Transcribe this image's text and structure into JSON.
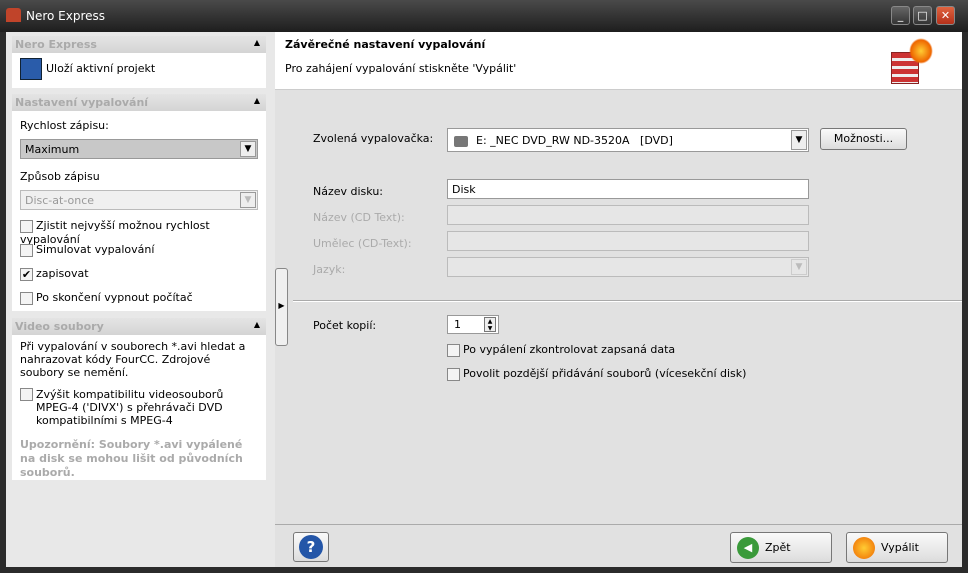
{
  "window": {
    "title": "Nero Express"
  },
  "left": {
    "sec1": {
      "title": "Nero Express",
      "save": "Uloží aktivní projekt"
    },
    "sec2": {
      "title": "Nastavení vypalování",
      "speed_label": "Rychlost zápisu:",
      "speed_value": "Maximum",
      "method_label": "Způsob zápisu",
      "method_value": "Disc-at-once",
      "checks": [
        {
          "label": "Zjistit nejvyšší možnou rychlost vypalování",
          "checked": false
        },
        {
          "label": "Simulovat vypalování",
          "checked": false
        },
        {
          "label": "zapisovat",
          "checked": true
        },
        {
          "label": "Po skončení vypnout počítač",
          "checked": false
        }
      ]
    },
    "sec3": {
      "title": "Video soubory",
      "desc": "Při vypalování v souborech *.avi hledat a nahrazovat kódy FourCC. Zdrojové soubory se nemění.",
      "check": "Zvýšit kompatibilitu videosouborů MPEG-4 ('DIVX') s přehrávači DVD kompatibilními s MPEG-4",
      "warning": "Upozornění: Soubory *.avi vypálené na disk se mohou lišit od původních souborů."
    }
  },
  "main": {
    "title": "Závěrečné nastavení vypalování",
    "subtitle": "Pro zahájení vypalování stiskněte 'Vypálit'",
    "recorder_label": "Zvolená vypalovačka:",
    "recorder_value": "E: _NEC DVD_RW ND-3520A   [DVD]",
    "options_btn": "Možnosti...",
    "disc_name_label": "Název disku:",
    "disc_name_value": "Disk",
    "cdtext_title_label": "Název (CD Text):",
    "cdtext_artist_label": "Umělec (CD-Text):",
    "language_label": "Jazyk:",
    "copies_label": "Počet kopií:",
    "copies_value": "1",
    "verify_label": "Po vypálení zkontrolovat zapsaná data",
    "multisession_label": "Povolit pozdější přidávání souborů (vícesekční disk)"
  },
  "bottom": {
    "help": "?",
    "back": "Zpět",
    "burn": "Vypálit"
  }
}
